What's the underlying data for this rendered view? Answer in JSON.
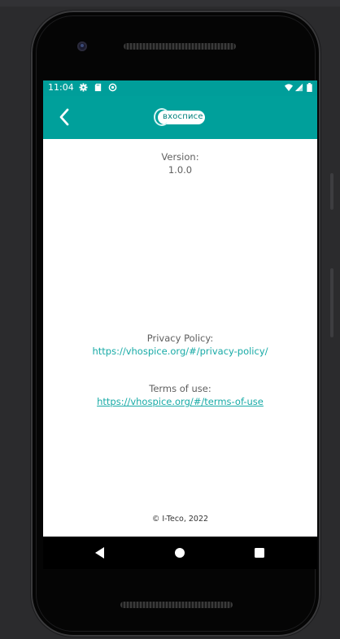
{
  "status_bar": {
    "time": "11:04",
    "left_icons": [
      "gear-icon",
      "sd-card-icon",
      "sync-icon"
    ],
    "right_icons": [
      "wifi-icon",
      "signal-icon",
      "battery-icon"
    ]
  },
  "app_bar": {
    "logo_text": "вхосписе",
    "back_icon": "chevron-left-icon",
    "color": "#00a09b"
  },
  "about": {
    "version_label": "Version:",
    "version_value": "1.0.0",
    "privacy_label": "Privacy Policy:",
    "privacy_url": "https://vhospice.org/#/privacy-policy/",
    "terms_label": "Terms of use:",
    "terms_url": "https://vhospice.org/#/terms-of-use",
    "copyright": "© I-Teco, 2022"
  },
  "nav_bar": {
    "buttons": [
      "back-triangle-icon",
      "home-circle-icon",
      "recents-square-icon"
    ]
  },
  "colors": {
    "accent": "#00a09b",
    "link": "#17aaa6",
    "label": "#5f5f5f"
  }
}
